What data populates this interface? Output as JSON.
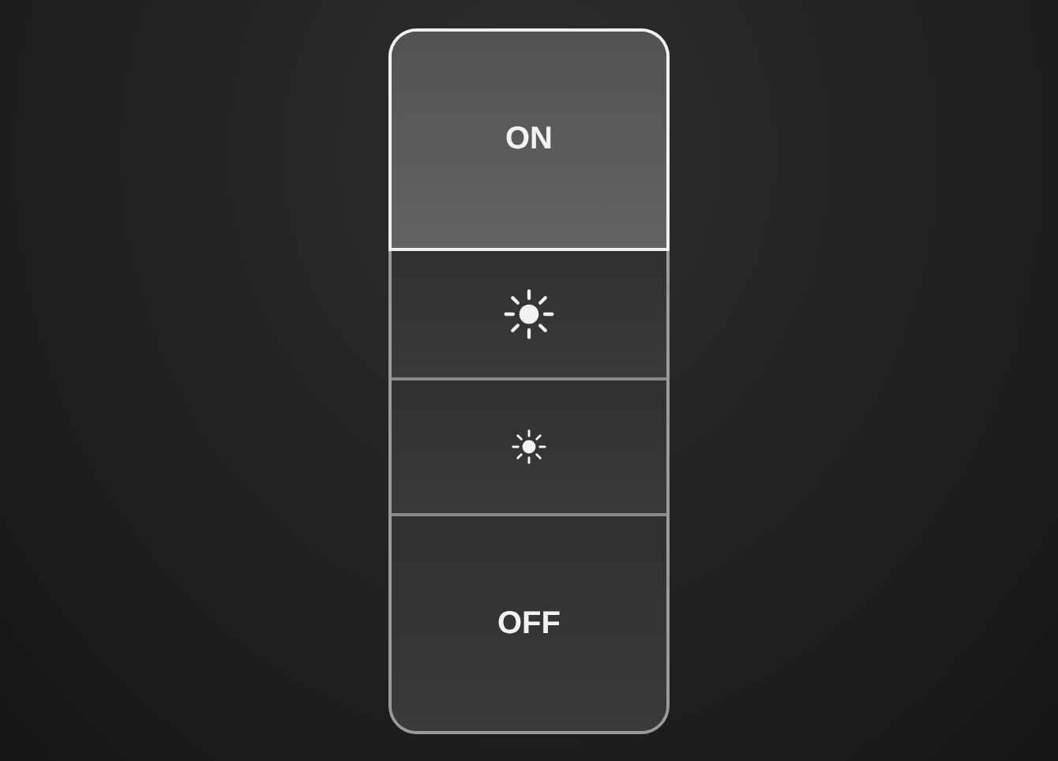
{
  "remote": {
    "buttons": [
      {
        "kind": "text",
        "label": "ON",
        "selected": true
      },
      {
        "kind": "brighten",
        "selected": false
      },
      {
        "kind": "dim",
        "selected": false
      },
      {
        "kind": "text",
        "label": "OFF",
        "selected": false
      }
    ]
  }
}
